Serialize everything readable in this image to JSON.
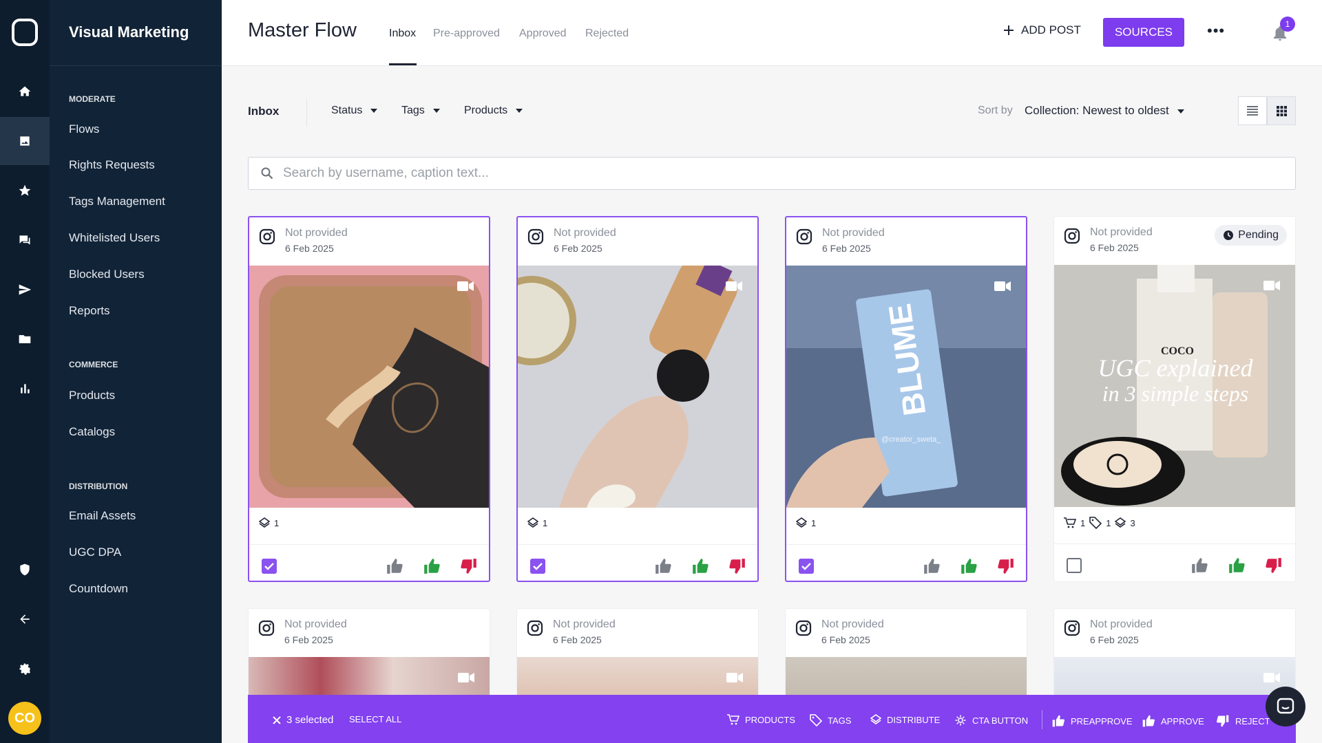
{
  "app": {
    "brand": "Visual Marketing",
    "avatar_initials": "CO"
  },
  "sidebar": {
    "sections": [
      {
        "title": "MODERATE"
      },
      {
        "title": "COMMERCE"
      },
      {
        "title": "DISTRIBUTION"
      }
    ],
    "items": [
      {
        "label": "Flows"
      },
      {
        "label": "Rights Requests"
      },
      {
        "label": "Tags Management"
      },
      {
        "label": "Whitelisted Users"
      },
      {
        "label": "Blocked Users"
      },
      {
        "label": "Reports"
      },
      {
        "label": "Products"
      },
      {
        "label": "Catalogs"
      },
      {
        "label": "Email Assets"
      },
      {
        "label": "UGC DPA"
      },
      {
        "label": "Countdown"
      }
    ]
  },
  "header": {
    "title": "Master Flow",
    "tabs": [
      {
        "label": "Inbox"
      },
      {
        "label": "Pre-approved"
      },
      {
        "label": "Approved"
      },
      {
        "label": "Rejected"
      }
    ],
    "add_post": "ADD POST",
    "sources": "SOURCES",
    "notification_count": "1"
  },
  "filters": {
    "inbox_label": "Inbox",
    "status": "Status",
    "tags": "Tags",
    "products": "Products",
    "sort_label": "Sort by",
    "sort_value": "Collection: Newest to oldest"
  },
  "search": {
    "placeholder": "Search by username, caption text..."
  },
  "cards": [
    {
      "source": "Not provided",
      "date": "6 Feb 2025",
      "layers": "1",
      "selected": true
    },
    {
      "source": "Not provided",
      "date": "6 Feb 2025",
      "layers": "1",
      "selected": true
    },
    {
      "source": "Not provided",
      "date": "6 Feb 2025",
      "layers": "1",
      "selected": true,
      "image_text": "BLUME",
      "handle": "@creator_sweta_"
    },
    {
      "source": "Not provided",
      "date": "6 Feb 2025",
      "status": "Pending",
      "products": "1",
      "tags": "1",
      "layers": "3",
      "selected": false,
      "overlay_line1": "UGC explained",
      "overlay_line2": "in 3 simple steps",
      "brand_text": "COCO"
    },
    {
      "source": "Not provided",
      "date": "6 Feb 2025"
    },
    {
      "source": "Not provided",
      "date": "6 Feb 2025"
    },
    {
      "source": "Not provided",
      "date": "6 Feb 2025"
    },
    {
      "source": "Not provided",
      "date": "6 Feb 2025"
    }
  ],
  "bulk_bar": {
    "selected_text": "3 selected",
    "select_all": "SELECT ALL",
    "products": "PRODUCTS",
    "tags": "TAGS",
    "distribute": "DISTRIBUTE",
    "cta": "CTA BUTTON",
    "preapprove": "PREAPPROVE",
    "approve": "APPROVE",
    "reject": "REJECT"
  },
  "colors": {
    "accent": "#7d3ced",
    "sidebar": "#112337",
    "approve": "#2aa144",
    "reject": "#d81e4a"
  }
}
